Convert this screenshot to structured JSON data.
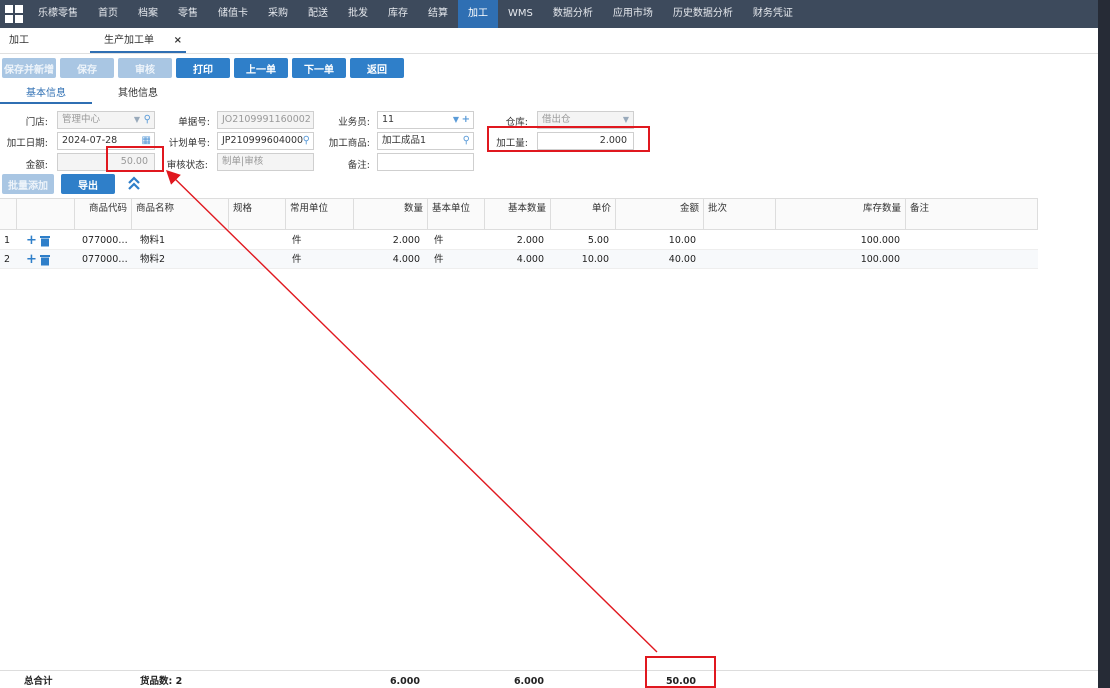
{
  "nav": {
    "items": [
      "乐檬零售",
      "首页",
      "档案",
      "零售",
      "储值卡",
      "采购",
      "配送",
      "批发",
      "库存",
      "结算",
      "加工",
      "WMS",
      "数据分析",
      "应用市场",
      "历史数据分析",
      "财务凭证"
    ],
    "active_index": 10
  },
  "tabs": {
    "t1": "加工",
    "t2": "生产加工单",
    "close": "×"
  },
  "toolbar": {
    "save_new": "保存并新增",
    "save": "保存",
    "audit": "审核",
    "print": "打印",
    "prev": "上一单",
    "next": "下一单",
    "back": "返回"
  },
  "subtabs": {
    "basic": "基本信息",
    "other": "其他信息"
  },
  "form": {
    "store_label": "门店:",
    "store_value": "管理中心",
    "doc_no_label": "单据号:",
    "doc_no_value": "JO2109991160002",
    "clerk_label": "业务员:",
    "clerk_value": "11",
    "warehouse_label": "仓库:",
    "warehouse_value": "借出仓",
    "date_label": "加工日期:",
    "date_value": "2024-07-28",
    "plan_no_label": "计划单号:",
    "plan_no_value": "JP210999604000",
    "product_label": "加工商品:",
    "product_value": "加工成品1",
    "qty_label": "加工量:",
    "qty_value": "2.000",
    "amount_label": "金额:",
    "amount_value": "50.00",
    "audit_status_label": "审核状态:",
    "audit_status_value": "制单|审核",
    "remark_label": "备注:",
    "remark_value": ""
  },
  "actions": {
    "batch_add": "批量添加",
    "export": "导出"
  },
  "table": {
    "headers": [
      "商品代码",
      "商品名称",
      "规格",
      "常用单位",
      "数量",
      "基本单位",
      "基本数量",
      "单价",
      "金额",
      "批次",
      "库存数量",
      "备注"
    ],
    "rows": [
      {
        "idx": "1",
        "code": "077000…",
        "name": "物料1",
        "spec": "",
        "unit": "件",
        "qty": "2.000",
        "base_unit": "件",
        "base_qty": "2.000",
        "price": "5.00",
        "amount": "10.00",
        "batch": "",
        "stock": "100.000",
        "remark": ""
      },
      {
        "idx": "2",
        "code": "077000…",
        "name": "物料2",
        "spec": "",
        "unit": "件",
        "qty": "4.000",
        "base_unit": "件",
        "base_qty": "4.000",
        "price": "10.00",
        "amount": "40.00",
        "batch": "",
        "stock": "100.000",
        "remark": ""
      }
    ]
  },
  "footer": {
    "total_label": "总合计",
    "item_count": "货品数: 2",
    "qty_total": "6.000",
    "base_qty_total": "6.000",
    "amount_total": "50.00"
  },
  "colors": {
    "nav_bg": "#3d4a5c",
    "active": "#2f6fb3",
    "annotation": "#e0181f"
  }
}
